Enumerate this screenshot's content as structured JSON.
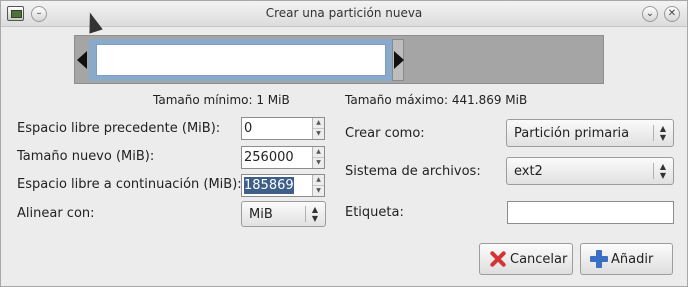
{
  "window": {
    "title": "Crear una partición nueva",
    "titlebar_icons": [
      "app-icon",
      "menu-icon",
      "minimize-icon",
      "close-icon"
    ],
    "minimize_glyph": "⌄",
    "close_glyph": "✕",
    "menu_glyph": "–"
  },
  "partition_bar": {
    "min_size_label": "Tamaño mínimo: 1 MiB",
    "max_size_label": "Tamaño máximo: 441.869 MiB",
    "colors": {
      "background": "#a5a5a5",
      "partition": "#8aaacc",
      "inner": "#ffffff"
    }
  },
  "form_left": {
    "free_before": {
      "label": "Espacio libre precedente (MiB):",
      "value": "0"
    },
    "new_size": {
      "label": "Tamaño nuevo (MiB):",
      "value": "256000"
    },
    "free_after": {
      "label": "Espacio libre a continuación (MiB):",
      "value": "185869"
    },
    "align_with": {
      "label": "Alinear con:",
      "value": "MiB"
    }
  },
  "form_right": {
    "create_as": {
      "label": "Crear como:",
      "value": "Partición primaria"
    },
    "filesystem": {
      "label": "Sistema de archivos:",
      "value": "ext2"
    },
    "label_field": {
      "label": "Etiqueta:",
      "value": ""
    }
  },
  "buttons": {
    "cancel_label": "Cancelar",
    "add_label": "Añadir"
  },
  "glyphs": {
    "spin_up": "▲",
    "spin_down": "▼",
    "combo_up": "▲",
    "combo_down": "▼"
  }
}
